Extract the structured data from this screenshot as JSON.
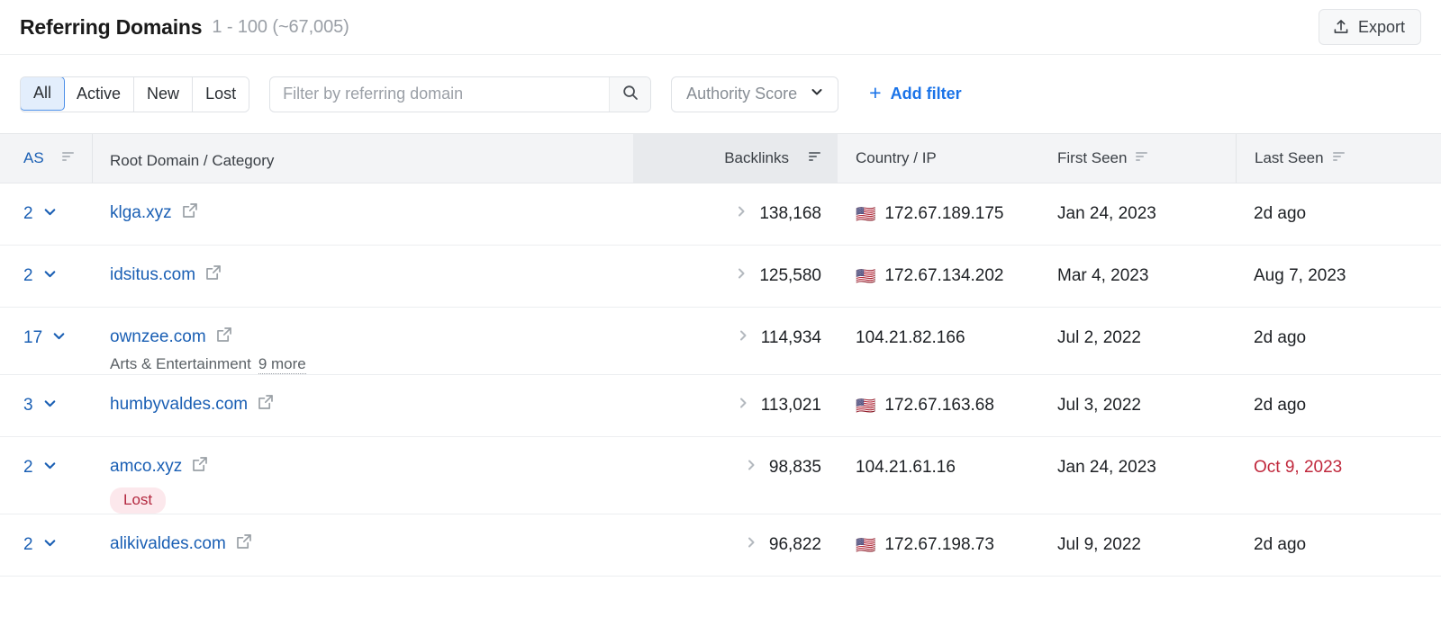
{
  "header": {
    "title": "Referring Domains",
    "count_range": "1 - 100 (~67,005)",
    "export_label": "Export",
    "export_icon": "upload-icon"
  },
  "filters": {
    "segments": [
      {
        "label": "All",
        "active": true
      },
      {
        "label": "Active",
        "active": false
      },
      {
        "label": "New",
        "active": false
      },
      {
        "label": "Lost",
        "active": false
      }
    ],
    "search": {
      "placeholder": "Filter by referring domain",
      "value": "",
      "icon": "search-icon"
    },
    "authority_select": {
      "label": "Authority Score",
      "icon": "chevron-down-icon"
    },
    "add_filter": {
      "label": "Add filter",
      "plus": "+",
      "color": "#1a73e8"
    }
  },
  "table": {
    "columns": [
      {
        "key": "as",
        "label": "AS",
        "sortable": true,
        "highlighted": false
      },
      {
        "key": "domain",
        "label": "Root Domain / Category",
        "sortable": false,
        "highlighted": false
      },
      {
        "key": "backlinks",
        "label": "Backlinks",
        "sortable": true,
        "highlighted": true
      },
      {
        "key": "country",
        "label": "Country / IP",
        "sortable": false,
        "highlighted": false
      },
      {
        "key": "first_seen",
        "label": "First Seen",
        "sortable": true,
        "highlighted": false
      },
      {
        "key": "last_seen",
        "label": "Last Seen",
        "sortable": true,
        "highlighted": false
      }
    ],
    "rows": [
      {
        "as": "2",
        "domain": "klga.xyz",
        "category": "",
        "more": "",
        "badge": "",
        "backlinks": "138,168",
        "flag": "🇺🇸",
        "ip": "172.67.189.175",
        "first_seen": "Jan 24, 2023",
        "last_seen": "2d ago",
        "last_seen_lost": false
      },
      {
        "as": "2",
        "domain": "idsitus.com",
        "category": "",
        "more": "",
        "badge": "",
        "backlinks": "125,580",
        "flag": "🇺🇸",
        "ip": "172.67.134.202",
        "first_seen": "Mar 4, 2023",
        "last_seen": "Aug 7, 2023",
        "last_seen_lost": false
      },
      {
        "as": "17",
        "domain": "ownzee.com",
        "category": "Arts & Entertainment",
        "more": "9 more",
        "badge": "",
        "backlinks": "114,934",
        "flag": "",
        "ip": "104.21.82.166",
        "first_seen": "Jul 2, 2022",
        "last_seen": "2d ago",
        "last_seen_lost": false
      },
      {
        "as": "3",
        "domain": "humbyvaldes.com",
        "category": "",
        "more": "",
        "badge": "",
        "backlinks": "113,021",
        "flag": "🇺🇸",
        "ip": "172.67.163.68",
        "first_seen": "Jul 3, 2022",
        "last_seen": "2d ago",
        "last_seen_lost": false
      },
      {
        "as": "2",
        "domain": "amco.xyz",
        "category": "",
        "more": "",
        "badge": "Lost",
        "backlinks": "98,835",
        "flag": "",
        "ip": "104.21.61.16",
        "first_seen": "Jan 24, 2023",
        "last_seen": "Oct 9, 2023",
        "last_seen_lost": true
      },
      {
        "as": "2",
        "domain": "alikivaldes.com",
        "category": "",
        "more": "",
        "badge": "",
        "backlinks": "96,822",
        "flag": "🇺🇸",
        "ip": "172.67.198.73",
        "first_seen": "Jul 9, 2022",
        "last_seen": "2d ago",
        "last_seen_lost": false
      }
    ]
  },
  "colors": {
    "link": "#1a5fb4",
    "accent": "#1a73e8",
    "lost_text": "#b3283f",
    "lost_bg": "#fce8ec",
    "date_lost": "#c0283c",
    "header_bg": "#f3f4f6",
    "header_highlight_bg": "#e8eaed"
  }
}
